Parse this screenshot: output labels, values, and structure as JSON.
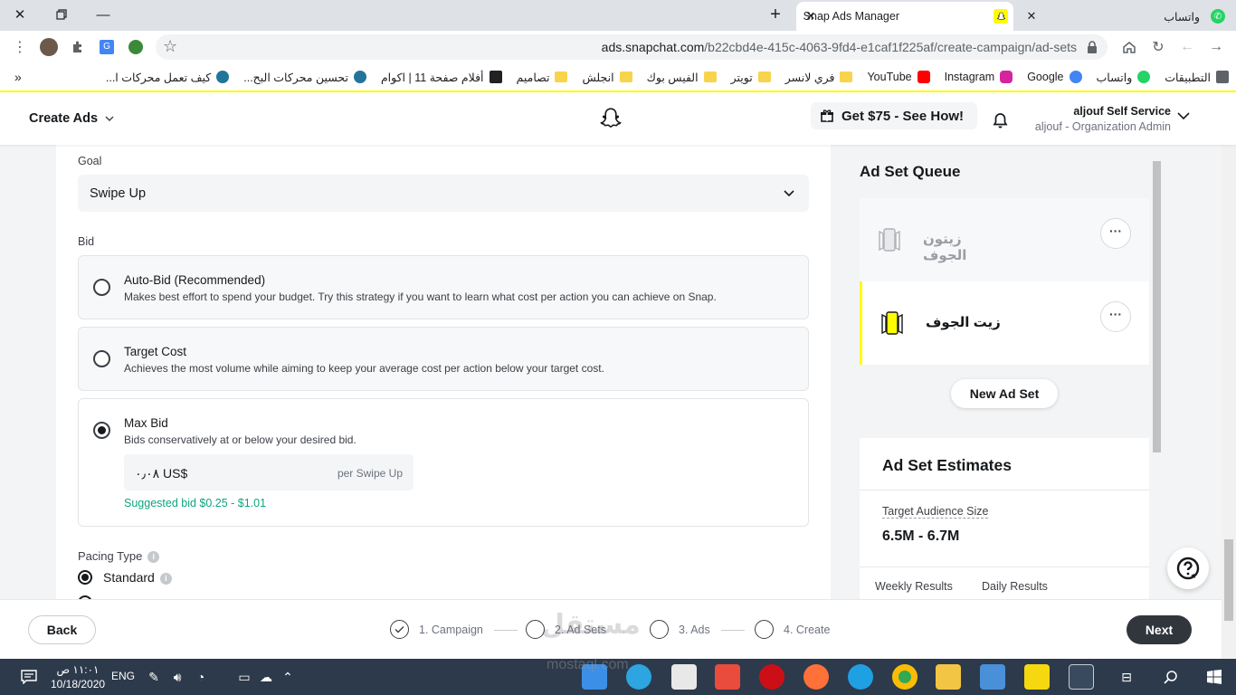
{
  "browser": {
    "tabs": [
      {
        "title": "Snap Ads Manager",
        "active": true
      },
      {
        "title": "واتساب",
        "active": false
      }
    ],
    "url_host": "ads.snapchat.com",
    "url_path": "/b22cbd4e-415c-4063-9fd4-e1caf1f225af/create-campaign/ad-sets",
    "bookmarks": [
      {
        "label": "التطبيقات",
        "icon": "apps-grid-icon"
      },
      {
        "label": "واتساب",
        "icon": "whatsapp-icon"
      },
      {
        "label": "Google",
        "icon": "google-icon"
      },
      {
        "label": "Instagram",
        "icon": "instagram-icon"
      },
      {
        "label": "YouTube",
        "icon": "youtube-icon"
      },
      {
        "label": "فري لانسر",
        "icon": "folder-icon"
      },
      {
        "label": "تويتر",
        "icon": "folder-icon"
      },
      {
        "label": "الفيس بوك",
        "icon": "folder-icon"
      },
      {
        "label": "انجلش",
        "icon": "folder-icon"
      },
      {
        "label": "تصاميم",
        "icon": "folder-icon"
      },
      {
        "label": "أفلام صفحة 11 | اكوام",
        "icon": "akwam-icon"
      },
      {
        "label": "تحسين محركات البح...",
        "icon": "wordpress-icon"
      },
      {
        "label": "كيف تعمل محركات ا...",
        "icon": "wordpress-icon"
      }
    ],
    "more_label": "»"
  },
  "header": {
    "create_ads": "Create Ads",
    "promo": "Get $75 - See How!",
    "account_name": "aljouf Self Service",
    "account_role": "aljouf - Organization Admin"
  },
  "form": {
    "goal_label": "Goal",
    "goal_value": "Swipe Up",
    "bid_label": "Bid",
    "options": [
      {
        "title": "Auto-Bid (Recommended)",
        "desc": "Makes best effort to spend your budget. Try this strategy if you want to learn what cost per action you can achieve on Snap.",
        "selected": false
      },
      {
        "title": "Target Cost",
        "desc": "Achieves the most volume while aiming to keep your average cost per action below your target cost.",
        "selected": false
      },
      {
        "title": "Max Bid",
        "desc": "Bids conservatively at or below your desired bid.",
        "selected": true
      }
    ],
    "bid_value": "٠٫٠٨ US$",
    "bid_unit": "per Swipe Up",
    "suggested": "Suggested bid $0.25 - $1.01",
    "pacing_label": "Pacing Type",
    "pacing_standard": "Standard"
  },
  "queue": {
    "title": "Ad Set Queue",
    "items": [
      {
        "name": "زيتون الجوف",
        "active": false
      },
      {
        "name": "زيت الجوف",
        "active": true
      }
    ],
    "new_adset": "New Ad Set"
  },
  "estimates": {
    "title": "Ad Set Estimates",
    "audience_label": "Target Audience Size",
    "audience_value": "6.5M - 6.7M",
    "weekly": "Weekly Results",
    "daily": "Daily Results"
  },
  "footer": {
    "back": "Back",
    "next": "Next",
    "steps": [
      "1. Campaign",
      "2. Ad Sets",
      "3. Ads",
      "4. Create"
    ],
    "watermark": "مستقل",
    "watermark_url": "mostaql.com"
  },
  "taskbar": {
    "lang": "ENG",
    "time": "١١:٠١ ص",
    "date": "10/18/2020"
  },
  "colors": {
    "snap_yellow": "#fffc00",
    "suggest_green": "#0fa47f",
    "next_bg": "#31363d",
    "taskbar": "#2d3a4b"
  }
}
